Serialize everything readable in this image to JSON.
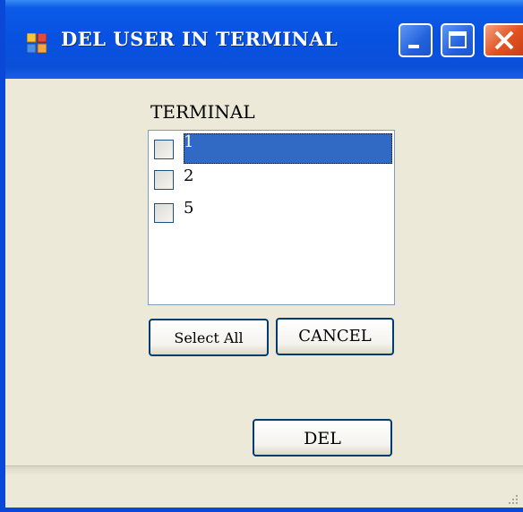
{
  "window": {
    "title": "DEL USER IN TERMINAL",
    "controls": [
      "minimize-icon",
      "maximize-icon",
      "close-icon"
    ]
  },
  "terminal_label": "TERMINAL",
  "terminals": [
    {
      "label": "1",
      "checked": false,
      "selected": true
    },
    {
      "label": "2",
      "checked": false,
      "selected": false
    },
    {
      "label": "5",
      "checked": false,
      "selected": false
    }
  ],
  "buttons": {
    "select_all": "Select All",
    "cancel": "CANCEL",
    "del": "DEL"
  },
  "colors": {
    "titlebar": "#0a4fd8",
    "selection": "#316ac5",
    "window_bg": "#ece9d8",
    "close_button": "#e2521f"
  }
}
